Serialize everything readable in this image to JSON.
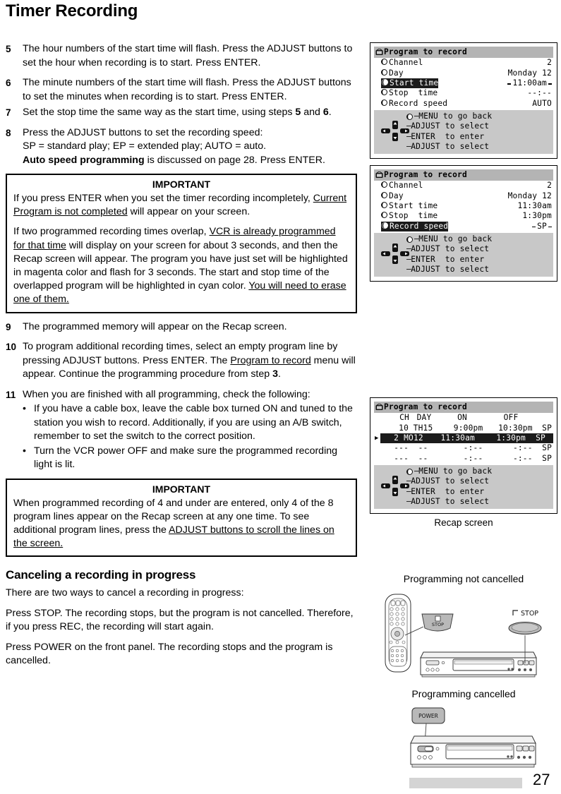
{
  "page_title": "Timer Recording",
  "page_number": "27",
  "steps": [
    {
      "num": "5",
      "parts": [
        {
          "t": "The hour numbers of the start time will flash.  Press the ADJUST buttons to set the hour when recording is to start.  Press ENTER.",
          "style": "normal"
        }
      ]
    },
    {
      "num": "6",
      "parts": [
        {
          "t": "The minute numbers of the start time will flash.  Press the ADJUST buttons to set the minutes when recording is to start.  Press ENTER.",
          "style": "normal"
        }
      ]
    },
    {
      "num": "7",
      "parts": [
        {
          "t": "Set the stop time the same way as the start time, using steps ",
          "style": "normal"
        },
        {
          "t": "5",
          "style": "bold"
        },
        {
          "t": " and ",
          "style": "normal"
        },
        {
          "t": "6",
          "style": "bold"
        },
        {
          "t": ".",
          "style": "normal"
        }
      ]
    },
    {
      "num": "8",
      "parts": [
        {
          "t": "Press the ADJUST buttons to set the recording speed:\nSP = standard play; EP = extended play; AUTO = auto.\n",
          "style": "normal"
        },
        {
          "t": "Auto speed programming",
          "style": "bold"
        },
        {
          "t": " is discussed on page 28.  Press ENTER.",
          "style": "normal"
        }
      ]
    }
  ],
  "important_1": {
    "title": "IMPORTANT",
    "paragraphs": [
      [
        {
          "t": "If you press ENTER when you set the timer recording incompletely, ",
          "style": "normal"
        },
        {
          "t": "Current Program is not completed",
          "style": "underline"
        },
        {
          "t": " will appear on your screen.",
          "style": "normal"
        }
      ],
      [
        {
          "t": "If two programmed recording times overlap, ",
          "style": "normal"
        },
        {
          "t": "VCR is already programmed for that time",
          "style": "underline"
        },
        {
          "t": " will display on your screen for about 3 seconds, and then the Recap screen will appear.  The program you have just set will be highlighted in magenta color and flash for 3 seconds.  The start and stop time of the overlapped program will be highlighted in cyan color.  ",
          "style": "normal"
        },
        {
          "t": "You will need to erase one of them.",
          "style": "underline"
        }
      ]
    ]
  },
  "steps_2": [
    {
      "num": "9",
      "parts": [
        {
          "t": "The programmed memory will appear on the Recap screen.",
          "style": "normal"
        }
      ]
    },
    {
      "num": "10",
      "parts": [
        {
          "t": "To program additional recording times, select an empty program line by pressing ADJUST buttons.  Press ENTER.  The ",
          "style": "normal"
        },
        {
          "t": "Program to record",
          "style": "underline"
        },
        {
          "t": " menu will appear.  Continue the programming procedure from step ",
          "style": "normal"
        },
        {
          "t": "3",
          "style": "bold"
        },
        {
          "t": ".",
          "style": "normal"
        }
      ]
    }
  ],
  "step_11": {
    "num": "11",
    "intro": "When you are finished with all programming, check the following:",
    "bullets": [
      "If you have a cable box, leave the cable box turned ON and tuned to the station you wish to record.  Additionally, if you are using an A/B switch, remember to set the switch to the correct position.",
      "Turn the VCR power OFF and make sure the programmed recording light is lit."
    ],
    "bullet_char": "•"
  },
  "important_2": {
    "title": "IMPORTANT",
    "paragraphs": [
      [
        {
          "t": "When programmed recording of 4 and under are entered, only 4 of the 8 program lines appear on the Recap screen at any one time.  To see additional program lines, press the ",
          "style": "normal"
        },
        {
          "t": "ADJUST buttons to scroll the lines on the screen.",
          "style": "underline"
        }
      ]
    ]
  },
  "cancel_section": {
    "heading": "Canceling a recording in progress",
    "paragraphs": [
      "There are two ways to cancel a recording in progress:",
      "Press STOP.  The recording stops, but the program is not cancelled.  Therefore, if you press REC, the recording will start again.",
      "Press POWER on the front panel.  The recording stops and the program is cancelled."
    ]
  },
  "osd_help": {
    "lines": [
      "MENU to go back",
      "ADJUST to select",
      "ENTER  to enter",
      "ADJUST to select"
    ]
  },
  "osd_screen_1": {
    "title": "Program to record",
    "rows": [
      {
        "label": "Channel",
        "value": "2",
        "selected": false,
        "flashing": false
      },
      {
        "label": "Day",
        "value": "Monday 12",
        "selected": false,
        "flashing": false
      },
      {
        "label": "Start time",
        "value": "11:00am",
        "selected": true,
        "flashing": true
      },
      {
        "label": "Stop  time",
        "value": "--:--",
        "selected": false,
        "flashing": false
      },
      {
        "label": "Record speed",
        "value": "AUTO",
        "selected": false,
        "flashing": false
      }
    ]
  },
  "osd_screen_2": {
    "title": "Program to record",
    "rows": [
      {
        "label": "Channel",
        "value": "2",
        "selected": false,
        "flashing": false
      },
      {
        "label": "Day",
        "value": "Monday 12",
        "selected": false,
        "flashing": false
      },
      {
        "label": "Start time",
        "value": "11:30am",
        "selected": false,
        "flashing": false
      },
      {
        "label": "Stop  time",
        "value": "1:30pm",
        "selected": false,
        "flashing": false
      },
      {
        "label": "Record speed",
        "value": "SP",
        "selected": true,
        "flashing": true
      }
    ]
  },
  "osd_recap": {
    "title": "Program to record",
    "caption": "Recap screen",
    "columns": [
      "CH",
      "DAY",
      "ON",
      "OFF"
    ],
    "rows": [
      {
        "ch": "10",
        "day": "TH15",
        "on": "9:00pm",
        "off": "10:30pm",
        "speed": "SP",
        "selected": false
      },
      {
        "ch": "2",
        "day": "MO12",
        "on": "11:30am",
        "off": "1:30pm",
        "speed": "SP",
        "selected": true
      },
      {
        "ch": "---",
        "day": "--",
        "on": "-:--",
        "off": "-:--",
        "speed": "SP",
        "selected": false
      },
      {
        "ch": "---",
        "day": "--",
        "on": "-:--",
        "off": "-:--",
        "speed": "SP",
        "selected": false
      }
    ]
  },
  "illustrations": {
    "fig_1_label": "Programming not cancelled",
    "fig_1_callout": "STOP",
    "fig_1_vcr_callout": "STOP",
    "fig_2_label": "Programming cancelled",
    "fig_2_callout": "POWER"
  },
  "colors": {
    "osd_titlebar": "#b4b4b4",
    "osd_helpbox": "#c8c8c8",
    "osd_highlight": "#1b1b1b",
    "footer_bar": "#d4d4d4"
  }
}
